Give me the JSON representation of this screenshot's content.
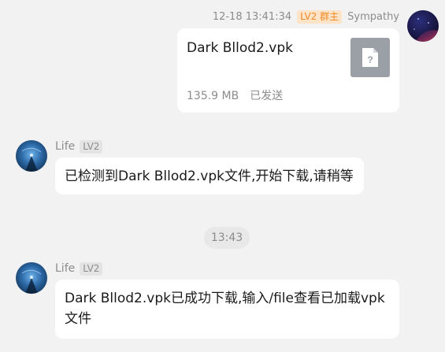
{
  "outgoing": {
    "timestamp": "12-18 13:41:34",
    "level_badge": "LV2 群主",
    "sender": "Sympathy",
    "file": {
      "name": "Dark Bllod2.vpk",
      "size": "135.9 MB",
      "status": "已发送",
      "icon": "unknown-file-icon"
    }
  },
  "messages": [
    {
      "sender": "Life",
      "level_badge": "LV2",
      "text": "已检测到Dark Bllod2.vpk文件,开始下载,请稍等"
    },
    {
      "sender": "Life",
      "level_badge": "LV2",
      "text": "Dark Bllod2.vpk已成功下载,输入/file查看已加载vpk文件"
    }
  ],
  "time_divider": "13:43",
  "colors": {
    "background": "#f2f2f2",
    "bubble": "#ffffff",
    "owner_badge_bg": "#fde3c7",
    "owner_badge_text": "#f08a24",
    "file_icon": "#9aa0a6"
  }
}
